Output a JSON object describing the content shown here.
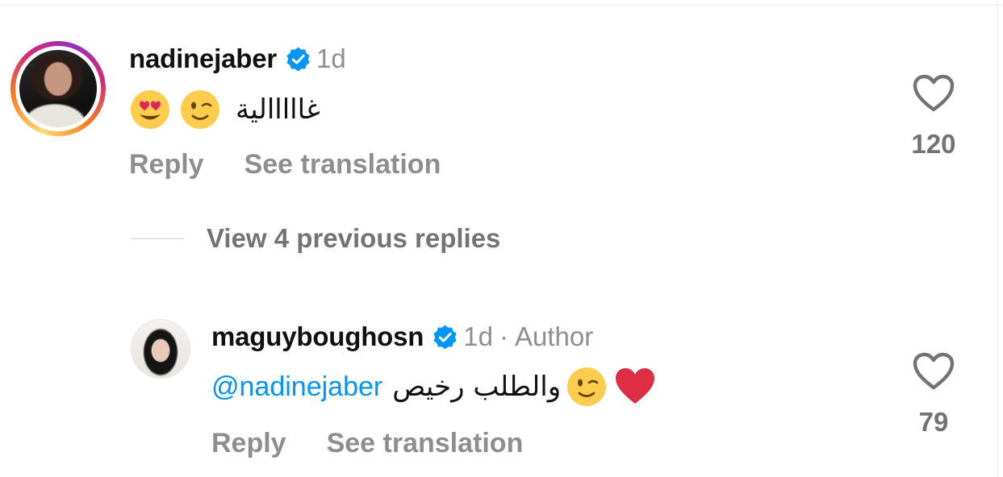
{
  "comments": [
    {
      "username": "nadinejaber",
      "verified": true,
      "time": "1d",
      "text": "غااااالية",
      "emojis": [
        "smiling-face-with-heart-eyes",
        "winking-face"
      ],
      "actions": {
        "reply": "Reply",
        "translate": "See translation"
      },
      "likes": "120"
    },
    {
      "username": "maguyboughosn",
      "verified": true,
      "time": "1d",
      "separator": "·",
      "badge": "Author",
      "mention": "@nadinejaber",
      "text": "والطلب رخيص",
      "emojis": [
        "winking-face",
        "red-heart"
      ],
      "actions": {
        "reply": "Reply",
        "translate": "See translation"
      },
      "likes": "79"
    }
  ],
  "view_replies": "View 4 previous replies",
  "colors": {
    "verified_blue": "#0095f6",
    "mention_blue": "#0095f6",
    "muted_gray": "#8e8e8e"
  }
}
